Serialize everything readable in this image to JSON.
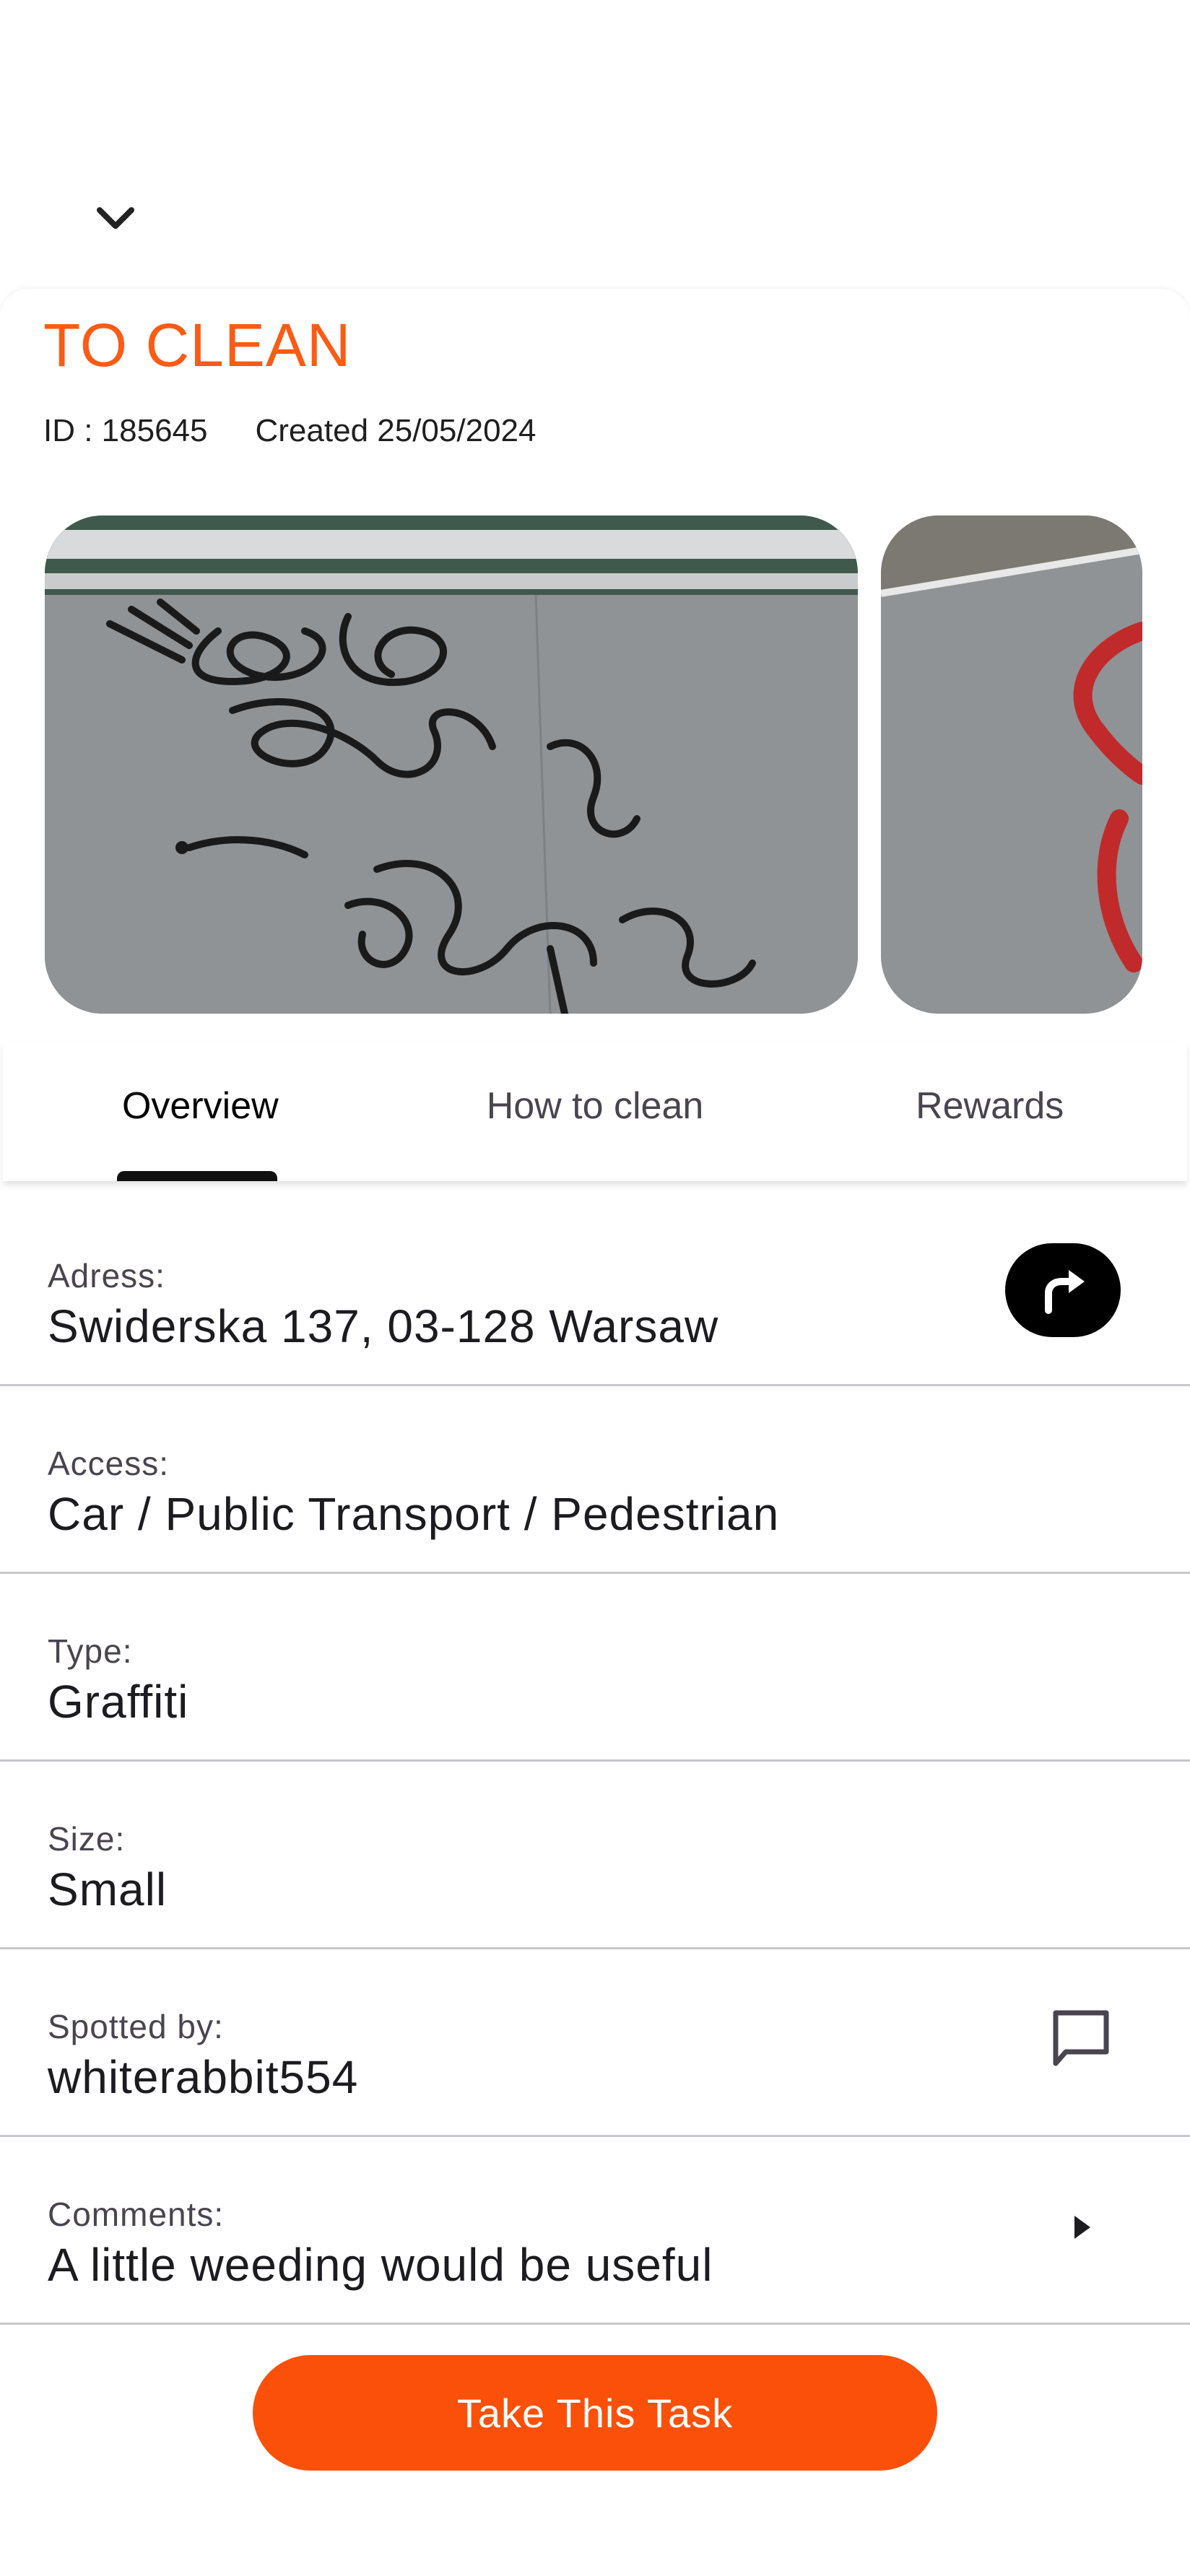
{
  "header": {
    "collapse_icon": "chevron-down-icon"
  },
  "task": {
    "status": "TO CLEAN",
    "id_text": "ID : 185645",
    "created_text": "Created 25/05/2024",
    "status_color": "#fb5b14"
  },
  "gallery": {
    "photos": [
      "graffiti-photo-1",
      "graffiti-photo-2"
    ]
  },
  "tabs": [
    {
      "label": "Overview",
      "active": true
    },
    {
      "label": "How to clean",
      "active": false
    },
    {
      "label": "Rewards",
      "active": false
    }
  ],
  "details": {
    "address": {
      "label": "Adress:",
      "value": "Swiderska 137, 03-128 Warsaw",
      "action_icon": "directions-icon"
    },
    "access": {
      "label": "Access:",
      "value": "Car / Public Transport / Pedestrian"
    },
    "type": {
      "label": "Type:",
      "value": "Graffiti"
    },
    "size": {
      "label": "Size:",
      "value": "Small"
    },
    "spotted_by": {
      "label": "Spotted by:",
      "value": "whiterabbit554",
      "action_icon": "chat-icon"
    },
    "comments": {
      "label": "Comments:",
      "value": "A little weeding would be useful",
      "action_icon": "arrow-right-icon"
    }
  },
  "actions": {
    "take_task_label": "Take This Task",
    "accent_color": "#fb500a"
  }
}
